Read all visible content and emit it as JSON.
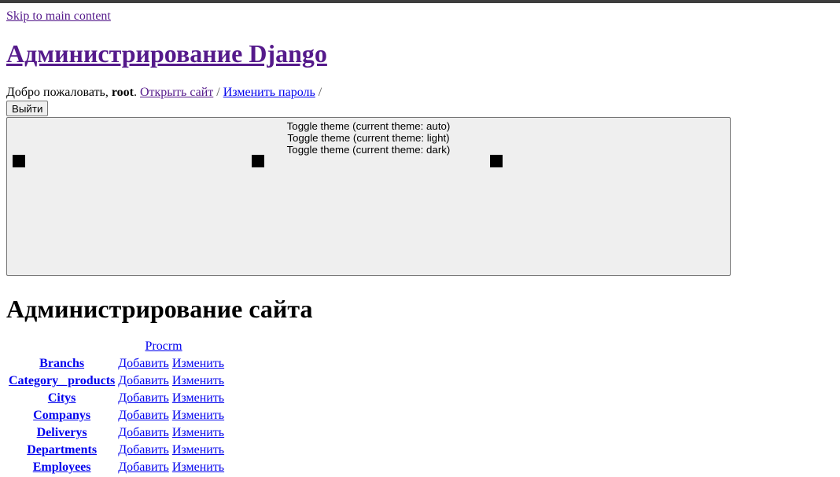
{
  "skip_link": "Skip to main content",
  "header": {
    "site_title": "Администрирование Django"
  },
  "user_tools": {
    "welcome": "Добро пожаловать,",
    "username": "root",
    "view_site": "Открыть сайт",
    "separator": "/",
    "change_password": "Изменить пароль",
    "separator2": "/",
    "logout": "Выйти"
  },
  "theme_toggle": {
    "labels": [
      "Toggle theme (current theme: auto)",
      "Toggle theme (current theme: light)",
      "Toggle theme (current theme: dark)"
    ]
  },
  "page": {
    "heading": "Администрирование сайта"
  },
  "app": {
    "name": "Procrm",
    "models": [
      {
        "name": "Branchs",
        "add": "Добавить",
        "change": "Изменить"
      },
      {
        "name": "Category_ products",
        "add": "Добавить",
        "change": "Изменить"
      },
      {
        "name": "Citys",
        "add": "Добавить",
        "change": "Изменить"
      },
      {
        "name": "Companys",
        "add": "Добавить",
        "change": "Изменить"
      },
      {
        "name": "Deliverys",
        "add": "Добавить",
        "change": "Изменить"
      },
      {
        "name": "Departments",
        "add": "Добавить",
        "change": "Изменить"
      },
      {
        "name": "Employees",
        "add": "Добавить",
        "change": "Изменить"
      }
    ]
  }
}
